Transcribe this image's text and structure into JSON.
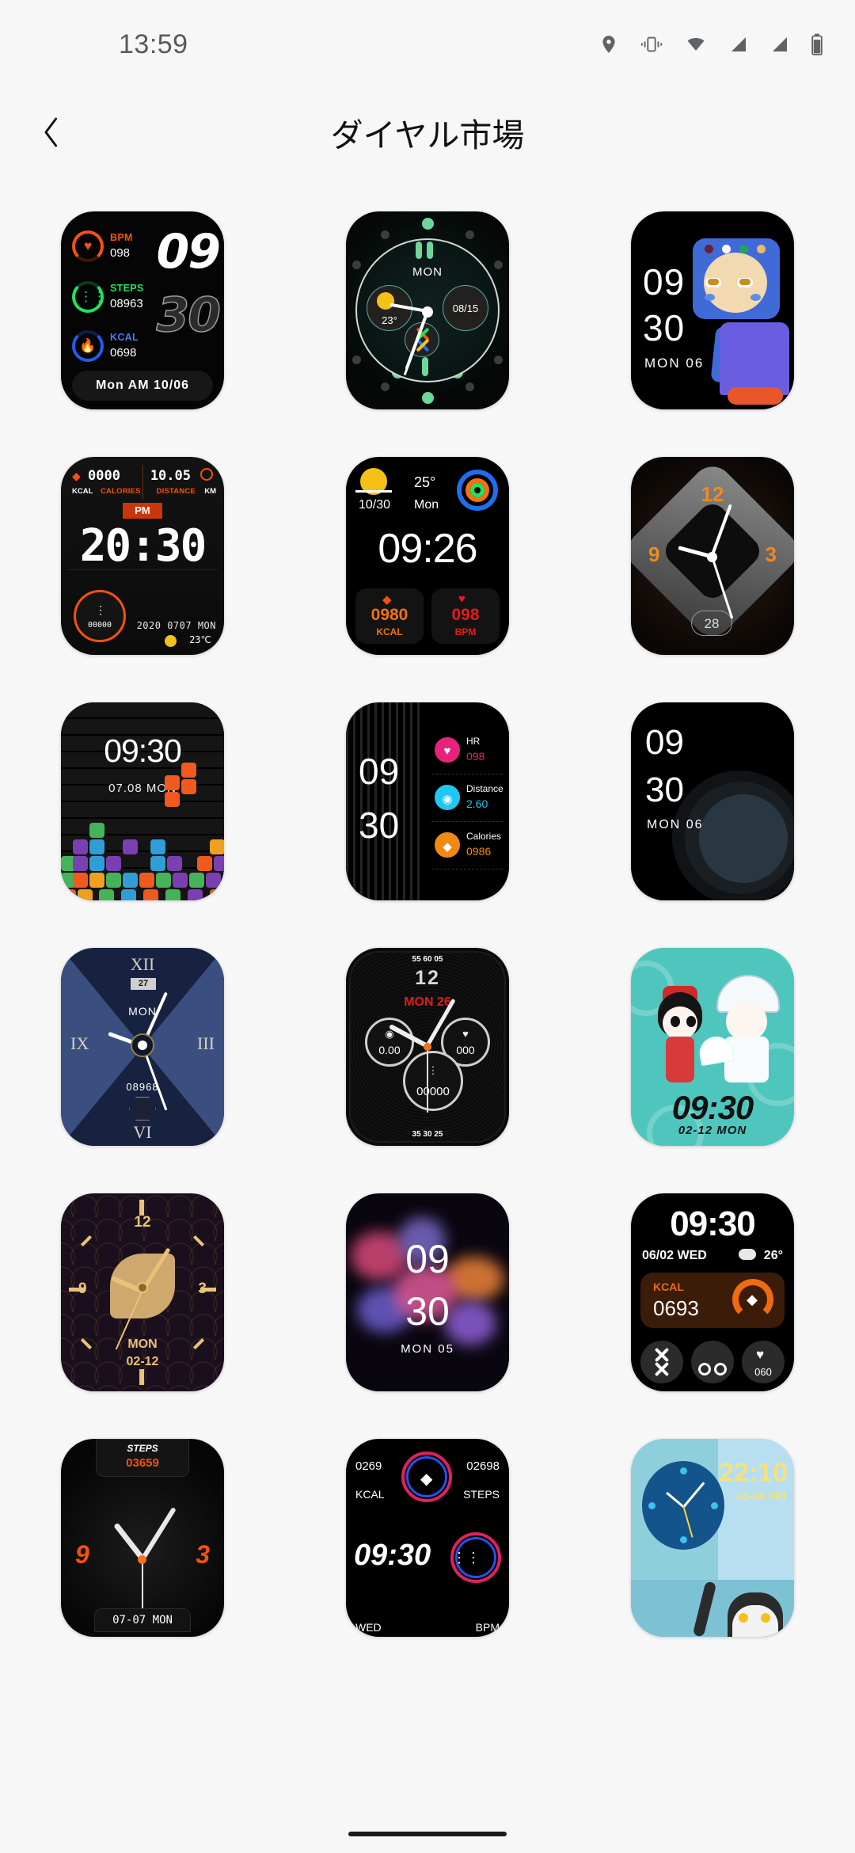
{
  "status_bar": {
    "time": "13:59",
    "icons": [
      "location-icon",
      "vibrate-icon",
      "wifi-icon",
      "signal-icon",
      "signal-icon",
      "battery-icon"
    ]
  },
  "app_bar": {
    "back_icon": "chevron-left-icon",
    "title": "ダイヤル市場"
  },
  "watch_faces": [
    {
      "id": 1,
      "name": "fitness-rings-digital",
      "bpm_label": "BPM",
      "bpm_value": "098",
      "steps_label": "STEPS",
      "steps_value": "08963",
      "kcal_label": "KCAL",
      "kcal_value": "0698",
      "hour": "09",
      "minute": "30",
      "date_line": "Mon  AM  10/06"
    },
    {
      "id": 2,
      "name": "analog-green-dots",
      "weekday": "MON",
      "temperature": "23°",
      "date": "08/15"
    },
    {
      "id": 3,
      "name": "blue-cartoon-character",
      "hour": "09",
      "minute": "30",
      "date_line": "MON 06"
    },
    {
      "id": 4,
      "name": "sport-dashboard",
      "kcal_value": "0000",
      "kcal_label": "KCAL",
      "calories_label": "CALORIES",
      "distance_value": "10.05",
      "distance_label": "DISTANCE",
      "distance_unit": "KM",
      "ampm": "PM",
      "time": "20:30",
      "steps_value": "00000",
      "date_line": "2020  0707  MON",
      "temperature": "23℃"
    },
    {
      "id": 5,
      "name": "weather-rings-cards",
      "temperature": "25°",
      "date": "10/30",
      "weekday": "Mon",
      "time": "09:26",
      "kcal_value": "0980",
      "kcal_label": "KCAL",
      "bpm_value": "098",
      "bpm_label": "BPM"
    },
    {
      "id": 6,
      "name": "diamond-analog-orange",
      "num_12": "12",
      "num_9": "9",
      "num_3": "3",
      "date": "28"
    },
    {
      "id": 7,
      "name": "tetris-blocks",
      "time": "09:30",
      "date_line": "07.08  MON"
    },
    {
      "id": 8,
      "name": "stripes-metrics",
      "hour": "09",
      "minute": "30",
      "hr_label": "HR",
      "hr_value": "098",
      "distance_label": "Distance",
      "distance_value": "2.60",
      "calories_label": "Calories",
      "calories_value": "0986"
    },
    {
      "id": 9,
      "name": "dark-circles-minimal",
      "hour": "09",
      "minute": "30",
      "date_line": "MON 06"
    },
    {
      "id": 10,
      "name": "roman-numeral-navy",
      "num_12": "XII",
      "num_3": "III",
      "num_6": "VI",
      "num_9": "IX",
      "date_badge": "27",
      "weekday": "MON",
      "steps_value": "08968"
    },
    {
      "id": 11,
      "name": "chronograph-silver",
      "top_ticks": "55          60          05",
      "bottom_ticks": "35          30          25",
      "twelve": "12",
      "date_line": "MON 26",
      "distance_value": "0.00",
      "hr_value": "000",
      "steps_value": "00000"
    },
    {
      "id": 12,
      "name": "chinese-opera-couple",
      "time": "09:30",
      "date_line": "02-12  MON"
    },
    {
      "id": 13,
      "name": "gold-wave-analog",
      "num_12": "12",
      "num_9": "9",
      "num_3": "3",
      "weekday": "MON",
      "date": "02-12"
    },
    {
      "id": 14,
      "name": "color-powder-explosion",
      "hour": "09",
      "minute": "30",
      "date_line": "MON  05"
    },
    {
      "id": 15,
      "name": "kcal-activity-tiles",
      "time": "09:30",
      "date_line": "06/02  WED",
      "temperature": "26°",
      "kcal_label": "KCAL",
      "kcal_value": "0693",
      "hr_value": "060",
      "tile_icons": [
        "cross-icon",
        "cycling-icon",
        "heart-icon"
      ]
    },
    {
      "id": 16,
      "name": "steps-orange-analog",
      "steps_label": "STEPS",
      "steps_value": "03659",
      "num_9": "9",
      "num_3": "3",
      "date_line": "07-07  MON"
    },
    {
      "id": 17,
      "name": "neon-rings-metrics",
      "kcal_value": "0269",
      "kcal_label": "KCAL",
      "steps_value": "02698",
      "steps_label": "STEPS",
      "time": "09:30",
      "weekday": "WED",
      "bpm_label": "BPM"
    },
    {
      "id": 18,
      "name": "cat-room-scene",
      "time": "22:10",
      "date_line": "03-06  FRI"
    }
  ],
  "colors": {
    "page_background": "#f7f7f7",
    "title_text": "#111111",
    "status_text": "#5a5a5a",
    "accent_orange": "#f4520f",
    "accent_green": "#1ee35e",
    "accent_blue": "#1e5df0"
  }
}
